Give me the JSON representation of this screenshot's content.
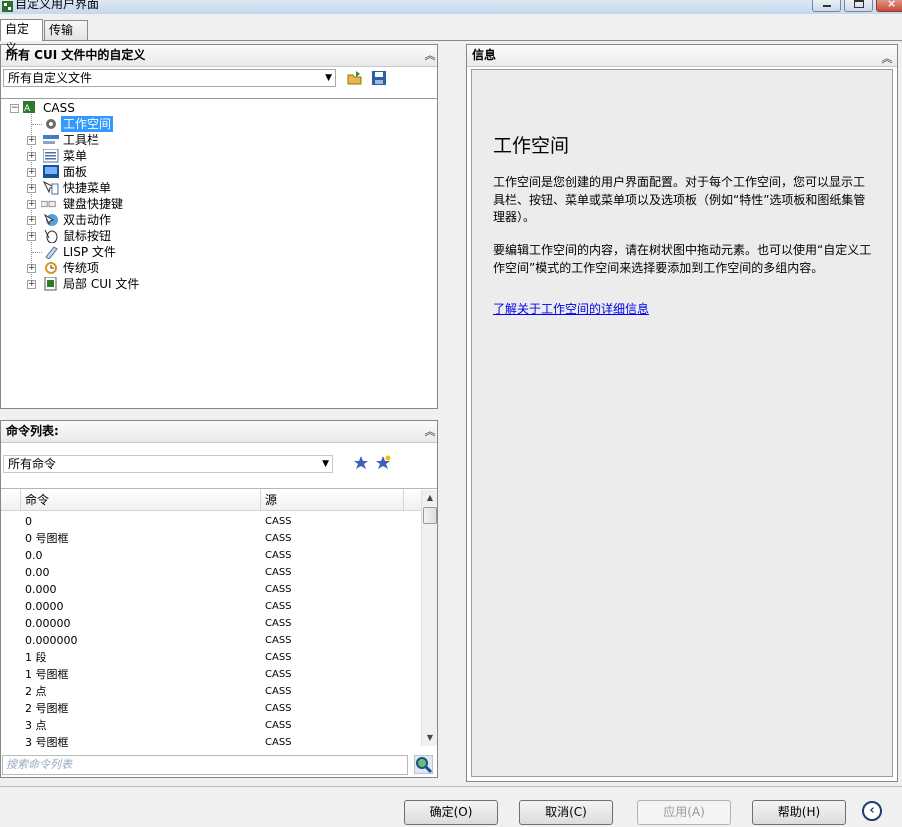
{
  "window": {
    "title": "自定义用户界面",
    "icons": {
      "app": "cui-app-icon",
      "minimize": "minimize-icon",
      "maximize": "maximize-icon",
      "close": "close-icon"
    }
  },
  "tabs": [
    {
      "label": "自定义",
      "active": true
    },
    {
      "label": "传输",
      "active": false
    }
  ],
  "customizations_panel": {
    "header": "所有 CUI 文件中的自定义",
    "filter_value": "所有自定义文件",
    "tree": [
      {
        "label": "CASS",
        "level": 0,
        "expanded": true,
        "icon": "cui-root-icon"
      },
      {
        "label": "工作空间",
        "level": 1,
        "selected": true,
        "icon": "gear-icon"
      },
      {
        "label": "工具栏",
        "level": 1,
        "icon": "toolbar-icon"
      },
      {
        "label": "菜单",
        "level": 1,
        "icon": "menu-icon"
      },
      {
        "label": "面板",
        "level": 1,
        "icon": "panel-icon"
      },
      {
        "label": "快捷菜单",
        "level": 1,
        "icon": "shortcut-menu-icon"
      },
      {
        "label": "键盘快捷键",
        "level": 1,
        "icon": "keyboard-icon"
      },
      {
        "label": "双击动作",
        "level": 1,
        "icon": "double-click-icon"
      },
      {
        "label": "鼠标按钮",
        "level": 1,
        "icon": "mouse-icon"
      },
      {
        "label": "LISP 文件",
        "level": 1,
        "icon": "lisp-icon"
      },
      {
        "label": "传统项",
        "level": 1,
        "icon": "legacy-icon"
      },
      {
        "label": "局部 CUI 文件",
        "level": 1,
        "icon": "partial-cui-icon"
      }
    ]
  },
  "command_panel": {
    "header": "命令列表:",
    "filter_value": "所有命令",
    "columns": [
      "命令",
      "源"
    ],
    "rows": [
      {
        "command": "0",
        "source": "CASS"
      },
      {
        "command": "0 号图框",
        "source": "CASS"
      },
      {
        "command": "0.0",
        "source": "CASS"
      },
      {
        "command": "0.00",
        "source": "CASS"
      },
      {
        "command": "0.000",
        "source": "CASS"
      },
      {
        "command": "0.0000",
        "source": "CASS"
      },
      {
        "command": "0.00000",
        "source": "CASS"
      },
      {
        "command": "0.000000",
        "source": "CASS"
      },
      {
        "command": "1 段",
        "source": "CASS"
      },
      {
        "command": "1 号图框",
        "source": "CASS"
      },
      {
        "command": "2 点",
        "source": "CASS"
      },
      {
        "command": "2 号图框",
        "source": "CASS"
      },
      {
        "command": "3 点",
        "source": "CASS"
      },
      {
        "command": "3 号图框",
        "source": "CASS"
      }
    ],
    "search_placeholder": "搜索命令列表"
  },
  "info_panel": {
    "header": "信息",
    "heading": "工作空间",
    "paragraph1": "工作空间是您创建的用户界面配置。对于每个工作空间，您可以显示工具栏、按钮、菜单或菜单项以及选项板（例如“特性”选项板和图纸集管理器）。",
    "paragraph2": "要编辑工作空间的内容，请在树状图中拖动元素。也可以使用“自定义工作空间”模式的工作空间来选择要添加到工作空间的多组内容。",
    "link": "了解关于工作空间的详细信息"
  },
  "buttons": {
    "ok": "确定(O)",
    "cancel": "取消(C)",
    "apply": "应用(A)",
    "help": "帮助(H)",
    "collapse_glyph": "‹"
  }
}
